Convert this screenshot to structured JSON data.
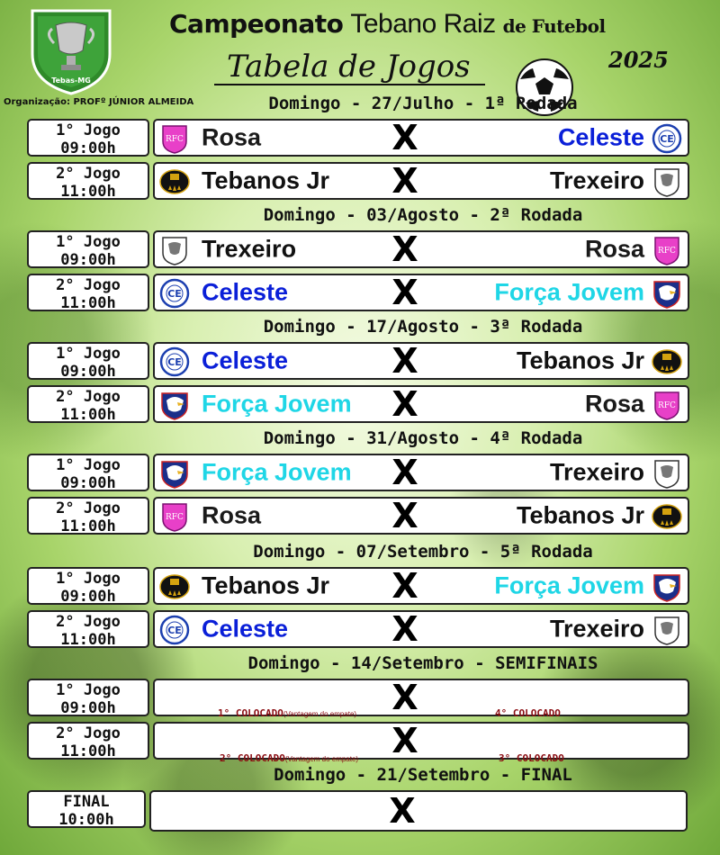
{
  "header": {
    "logo_text": "Tebas-MG",
    "organizer": "Organização: PROFº JÚNIOR ALMEIDA",
    "title_part1": "Campeonato",
    "title_part2": "Tebano Raiz",
    "title_part3": "de Futebol",
    "year": "2025",
    "subtitle": "Tabela de Jogos"
  },
  "vs_symbol": "X",
  "colors": {
    "Rosa": "#1a1a1a",
    "Celeste": "#0a1fd8",
    "Tebanos Jr": "#111111",
    "Trexeiro": "#111111",
    "Força Jovem": "#1fd6e6"
  },
  "rounds": [
    {
      "label": "Domingo - 27/Julho - 1ª Rodada",
      "matches": [
        {
          "game": "1° Jogo",
          "time": "09:00h",
          "home": "Rosa",
          "away": "Celeste"
        },
        {
          "game": "2° Jogo",
          "time": "11:00h",
          "home": "Tebanos Jr",
          "away": "Trexeiro"
        }
      ]
    },
    {
      "label": "Domingo - 03/Agosto - 2ª Rodada",
      "matches": [
        {
          "game": "1° Jogo",
          "time": "09:00h",
          "home": "Trexeiro",
          "away": "Rosa"
        },
        {
          "game": "2° Jogo",
          "time": "11:00h",
          "home": "Celeste",
          "away": "Força Jovem"
        }
      ]
    },
    {
      "label": "Domingo - 17/Agosto - 3ª Rodada",
      "matches": [
        {
          "game": "1° Jogo",
          "time": "09:00h",
          "home": "Celeste",
          "away": "Tebanos Jr"
        },
        {
          "game": "2° Jogo",
          "time": "11:00h",
          "home": "Força Jovem",
          "away": "Rosa"
        }
      ]
    },
    {
      "label": "Domingo - 31/Agosto - 4ª Rodada",
      "matches": [
        {
          "game": "1° Jogo",
          "time": "09:00h",
          "home": "Força Jovem",
          "away": "Trexeiro"
        },
        {
          "game": "2° Jogo",
          "time": "11:00h",
          "home": "Rosa",
          "away": "Tebanos Jr"
        }
      ]
    },
    {
      "label": "Domingo - 07/Setembro - 5ª Rodada",
      "matches": [
        {
          "game": "1° Jogo",
          "time": "09:00h",
          "home": "Tebanos Jr",
          "away": "Força Jovem"
        },
        {
          "game": "2° Jogo",
          "time": "11:00h",
          "home": "Celeste",
          "away": "Trexeiro"
        }
      ]
    }
  ],
  "semifinal": {
    "label": "Domingo - 14/Setembro - SEMIFINAIS",
    "matches": [
      {
        "game": "1° Jogo",
        "time": "09:00h",
        "home": "1° COLOCADO",
        "home_note": "(Vantagem do empate)",
        "away": "4° COLOCADO"
      },
      {
        "game": "2° Jogo",
        "time": "11:00h",
        "home": "2° COLOCADO",
        "home_note": "(Vantagem do empate)",
        "away": "3° COLOCADO"
      }
    ]
  },
  "final": {
    "label": "Domingo - 21/Setembro - FINAL",
    "game": "FINAL",
    "time": "10:00h"
  }
}
